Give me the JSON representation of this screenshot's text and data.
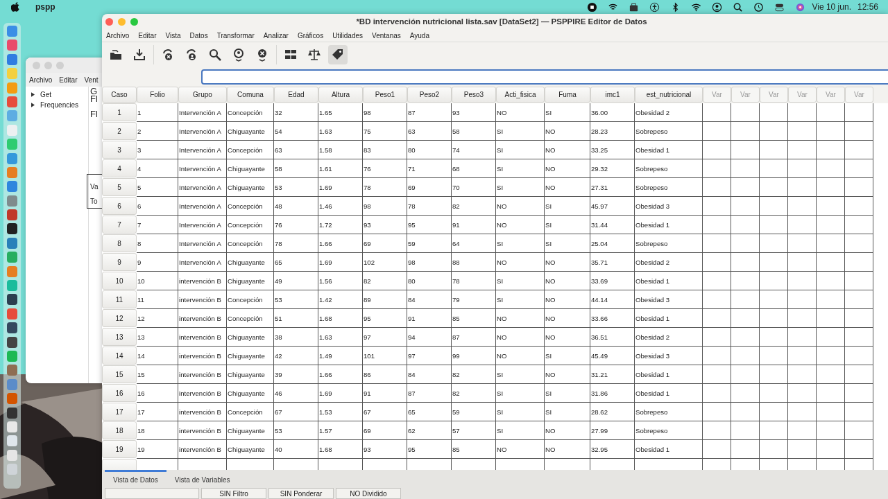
{
  "menubar": {
    "app": "pspp",
    "date": "Vie 10 jun.",
    "time": "12:56"
  },
  "back_window": {
    "menus": [
      "Archivo",
      "Editar",
      "Vent"
    ],
    "tree": [
      "Get",
      "Frequencies"
    ],
    "output_texts": [
      "G",
      "Fl",
      "Fl"
    ],
    "table_texts": [
      "Va",
      "To"
    ]
  },
  "window": {
    "title": "*BD intervención nutricional lista.sav [DataSet2] — PSPPIRE Editor de Datos"
  },
  "menus": [
    "Archivo",
    "Editar",
    "Vista",
    "Datos",
    "Transformar",
    "Analizar",
    "Gráficos",
    "Utilidades",
    "Ventanas",
    "Ayuda"
  ],
  "toolbar": [
    {
      "kind": "open",
      "selected": false
    },
    {
      "kind": "save",
      "selected": false
    },
    {
      "kind": "goto",
      "selected": false
    },
    {
      "kind": "gotovar",
      "selected": false
    },
    {
      "kind": "find",
      "selected": false
    },
    {
      "kind": "insertcase",
      "selected": false
    },
    {
      "kind": "insertvar",
      "selected": false
    },
    {
      "kind": "split",
      "selected": false
    },
    {
      "kind": "weight",
      "selected": false
    },
    {
      "kind": "labels",
      "selected": true
    }
  ],
  "table": {
    "corner": "Caso",
    "columns": [
      "Folio",
      "Grupo",
      "Comuna",
      "Edad",
      "Altura",
      "Peso1",
      "Peso2",
      "Peso3",
      "Acti_fisica",
      "Fuma",
      "imc1",
      "est_nutricional"
    ],
    "empty_columns": [
      "Var",
      "Var",
      "Var",
      "Var",
      "Var",
      "Var"
    ],
    "rows": [
      {
        "case": "1",
        "cells": [
          "1",
          "Intervención A",
          "Concepción",
          "32",
          "1.65",
          "98",
          "87",
          "93",
          "NO",
          "SI",
          "36.00",
          "Obesidad 2"
        ]
      },
      {
        "case": "2",
        "cells": [
          "2",
          "Intervención A",
          "Chiguayante",
          "54",
          "1.63",
          "75",
          "63",
          "58",
          "SI",
          "NO",
          "28.23",
          "Sobrepeso"
        ]
      },
      {
        "case": "3",
        "cells": [
          "3",
          "Intervención A",
          "Concepción",
          "63",
          "1.58",
          "83",
          "80",
          "74",
          "SI",
          "NO",
          "33.25",
          "Obesidad 1"
        ]
      },
      {
        "case": "4",
        "cells": [
          "4",
          "Intervención A",
          "Chiguayante",
          "58",
          "1.61",
          "76",
          "71",
          "68",
          "SI",
          "NO",
          "29.32",
          "Sobrepeso"
        ]
      },
      {
        "case": "5",
        "cells": [
          "5",
          "Intervención A",
          "Chiguayante",
          "53",
          "1.69",
          "78",
          "69",
          "70",
          "SI",
          "NO",
          "27.31",
          "Sobrepeso"
        ]
      },
      {
        "case": "6",
        "cells": [
          "6",
          "Intervención A",
          "Concepción",
          "48",
          "1.46",
          "98",
          "78",
          "82",
          "NO",
          "SI",
          "45.97",
          "Obesidad 3"
        ]
      },
      {
        "case": "7",
        "cells": [
          "7",
          "Intervención A",
          "Concepción",
          "76",
          "1.72",
          "93",
          "95",
          "91",
          "NO",
          "SI",
          "31.44",
          "Obesidad 1"
        ]
      },
      {
        "case": "8",
        "cells": [
          "8",
          "Intervención A",
          "Concepción",
          "78",
          "1.66",
          "69",
          "59",
          "64",
          "SI",
          "SI",
          "25.04",
          "Sobrepeso"
        ]
      },
      {
        "case": "9",
        "cells": [
          "9",
          "Intervención A",
          "Chiguayante",
          "65",
          "1.69",
          "102",
          "98",
          "88",
          "NO",
          "NO",
          "35.71",
          "Obesidad 2"
        ]
      },
      {
        "case": "10",
        "cells": [
          "10",
          "intervención B",
          "Chiguayante",
          "49",
          "1.56",
          "82",
          "80",
          "78",
          "SI",
          "NO",
          "33.69",
          "Obesidad 1"
        ]
      },
      {
        "case": "11",
        "cells": [
          "11",
          "intervención B",
          "Concepción",
          "53",
          "1.42",
          "89",
          "84",
          "79",
          "SI",
          "NO",
          "44.14",
          "Obesidad 3"
        ]
      },
      {
        "case": "12",
        "cells": [
          "12",
          "intervención B",
          "Concepción",
          "51",
          "1.68",
          "95",
          "91",
          "85",
          "NO",
          "NO",
          "33.66",
          "Obesidad 1"
        ]
      },
      {
        "case": "13",
        "cells": [
          "13",
          "intervención B",
          "Chiguayante",
          "38",
          "1.63",
          "97",
          "94",
          "87",
          "NO",
          "NO",
          "36.51",
          "Obesidad 2"
        ]
      },
      {
        "case": "14",
        "cells": [
          "14",
          "intervención B",
          "Chiguayante",
          "42",
          "1.49",
          "101",
          "97",
          "99",
          "NO",
          "SI",
          "45.49",
          "Obesidad 3"
        ]
      },
      {
        "case": "15",
        "cells": [
          "15",
          "intervención B",
          "Chiguayante",
          "39",
          "1.66",
          "86",
          "84",
          "82",
          "SI",
          "NO",
          "31.21",
          "Obesidad 1"
        ]
      },
      {
        "case": "16",
        "cells": [
          "16",
          "intervención B",
          "Chiguayante",
          "46",
          "1.69",
          "91",
          "87",
          "82",
          "SI",
          "SI",
          "31.86",
          "Obesidad 1"
        ]
      },
      {
        "case": "17",
        "cells": [
          "17",
          "intervención B",
          "Concepción",
          "67",
          "1.53",
          "67",
          "65",
          "59",
          "SI",
          "SI",
          "28.62",
          "Sobrepeso"
        ]
      },
      {
        "case": "18",
        "cells": [
          "18",
          "intervención B",
          "Chiguayante",
          "53",
          "1.57",
          "69",
          "62",
          "57",
          "SI",
          "NO",
          "27.99",
          "Sobrepeso"
        ]
      },
      {
        "case": "19",
        "cells": [
          "19",
          "intervención B",
          "Chiguayante",
          "40",
          "1.68",
          "93",
          "95",
          "85",
          "NO",
          "NO",
          "32.95",
          "Obesidad 1"
        ]
      }
    ]
  },
  "tabs": [
    {
      "label": "Vista de Datos",
      "selected": true
    },
    {
      "label": "Vista de Variables",
      "selected": false
    }
  ],
  "status_bar": [
    "SIN Filtro",
    "SIN Ponderar",
    "NO Dividido"
  ]
}
